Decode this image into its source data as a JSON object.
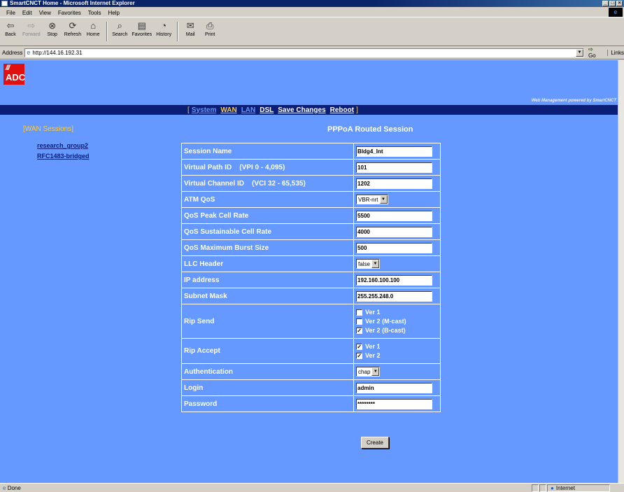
{
  "window": {
    "title": "SmartCNCT Home - Microsoft Internet Explorer",
    "controls": [
      "_",
      "□",
      "×"
    ]
  },
  "menu": [
    "File",
    "Edit",
    "View",
    "Favorites",
    "Tools",
    "Help"
  ],
  "toolbar": {
    "back": "Back",
    "forward": "Forward",
    "stop": "Stop",
    "refresh": "Refresh",
    "home": "Home",
    "search": "Search",
    "favorites": "Favorites",
    "history": "History",
    "mail": "Mail",
    "print": "Print"
  },
  "address": {
    "label": "Address",
    "url": "http://144.16.192.31",
    "go": "Go",
    "links": "Links"
  },
  "header": {
    "logo_text": "ADC",
    "powered_by": "Web Management powered by SmartCNCT"
  },
  "nav": {
    "open_bracket": "[",
    "close_bracket": "]",
    "items": [
      "System",
      "WAN",
      "LAN",
      "DSL",
      "Save Changes",
      "Reboot"
    ]
  },
  "sidebar": {
    "title": "[WAN Sessions]",
    "links": [
      "research_group2",
      "RFC1483-bridged"
    ]
  },
  "page_title": "PPPoA Routed Session",
  "form": {
    "session_name": {
      "label": "Session Name",
      "value": "Bldg4_Int"
    },
    "vpi": {
      "label": "Virtual Path ID",
      "hint": "(VPI 0 - 4,095)",
      "value": "101"
    },
    "vci": {
      "label": "Virtual Channel ID",
      "hint": "(VCI 32 - 65,535)",
      "value": "1202"
    },
    "atm_qos": {
      "label": "ATM QoS",
      "value": "VBR-nrt"
    },
    "peak_cell_rate": {
      "label": "QoS Peak Cell Rate",
      "value": "5500"
    },
    "sustainable_cell_rate": {
      "label": "QoS Sustainable Cell Rate",
      "value": "4000"
    },
    "max_burst": {
      "label": "QoS Maximum Burst Size",
      "value": "500"
    },
    "llc_header": {
      "label": "LLC Header",
      "value": "false"
    },
    "ip_address": {
      "label": "IP address",
      "value": "192.160.100.100"
    },
    "subnet_mask": {
      "label": "Subnet Mask",
      "value": "255.255.248.0"
    },
    "rip_send": {
      "label": "Rip Send",
      "options": [
        {
          "label": "Ver 1",
          "checked": false
        },
        {
          "label": "Ver 2 (M-cast)",
          "checked": false
        },
        {
          "label": "Ver 2 (B-cast)",
          "checked": true
        }
      ]
    },
    "rip_accept": {
      "label": "Rip Accept",
      "options": [
        {
          "label": "Ver 1",
          "checked": true
        },
        {
          "label": "Ver 2",
          "checked": true
        }
      ]
    },
    "authentication": {
      "label": "Authentication",
      "value": "chap"
    },
    "login": {
      "label": "Login",
      "value": "admin"
    },
    "password": {
      "label": "Password",
      "value": "********"
    },
    "create_label": "Create"
  },
  "status": {
    "text": "Done",
    "zone": "Internet"
  },
  "icons": {
    "back": "back-arrow-icon",
    "forward": "forward-arrow-icon",
    "stop": "stop-icon",
    "refresh": "refresh-icon",
    "home": "home-icon",
    "search": "search-icon",
    "favorites": "favorites-icon",
    "history": "history-icon",
    "mail": "mail-icon",
    "print": "print-icon"
  },
  "colors": {
    "page_background": "#6699ff",
    "nav_background": "#0a1e78",
    "nav_active": "#ffcc33",
    "logo_red": "#e01010"
  }
}
